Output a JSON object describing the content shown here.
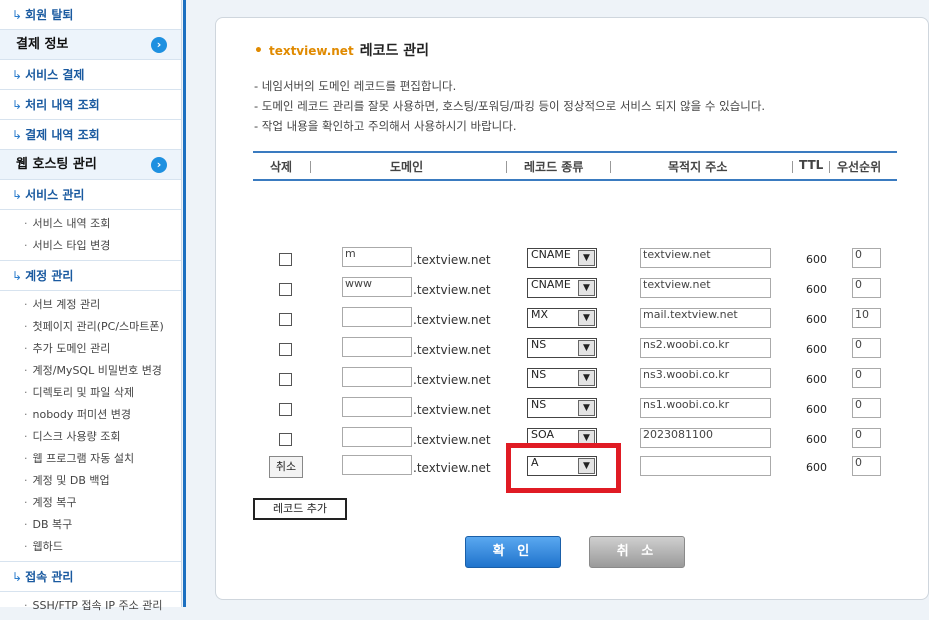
{
  "sidebar": {
    "sections": [
      {
        "label": "회원 탈퇴",
        "type": "link"
      },
      {
        "label": "결제 정보",
        "type": "header"
      },
      {
        "label": "서비스 결제",
        "type": "link"
      },
      {
        "label": "처리 내역 조회",
        "type": "link"
      },
      {
        "label": "결제 내역 조회",
        "type": "link"
      },
      {
        "label": "웹 호스팅 관리",
        "type": "header"
      },
      {
        "label": "서비스 관리",
        "type": "link"
      }
    ],
    "service_sub": [
      "서비스 내역 조회",
      "서비스 타입 변경"
    ],
    "account_label": "계정 관리",
    "account_sub": [
      "서브 계정 관리",
      "첫페이지 관리(PC/스마트폰)",
      "추가 도메인 관리",
      "계정/MySQL 비밀번호 변경",
      "디렉토리 및 파일 삭제",
      "nobody 퍼미션 변경",
      "디스크 사용량 조회",
      "웹 프로그램 자동 설치",
      "계정 및 DB 백업",
      "계정 복구",
      "DB 복구",
      "웹하드"
    ],
    "access_label": "접속 관리",
    "access_sub": [
      "SSH/FTP 접속 IP 주소 관리"
    ]
  },
  "main": {
    "domain": "textview.net",
    "title": "레코드 관리",
    "notes": [
      "- 네임서버의 도메인 레코드를 편집합니다.",
      "- 도메인 레코드 관리를 잘못 사용하면, 호스팅/포워딩/파킹 등이 정상적으로 서비스 되지 않을 수 있습니다.",
      "- 작업 내용을 확인하고 주의해서 사용하시기 바랍니다."
    ],
    "headers": {
      "delete": "삭제",
      "domain": "도메인",
      "type": "레코드 종류",
      "target": "목적지 주소",
      "ttl": "TTL",
      "priority": "우선순위"
    },
    "suffix": ".textview.net",
    "rows": [
      {
        "sub": "m",
        "type": "CNAME",
        "target": "textview.net",
        "ttl": "600",
        "priority": "0"
      },
      {
        "sub": "www",
        "type": "CNAME",
        "target": "textview.net",
        "ttl": "600",
        "priority": "0"
      },
      {
        "sub": "",
        "type": "MX",
        "target": "mail.textview.net",
        "ttl": "600",
        "priority": "10"
      },
      {
        "sub": "",
        "type": "NS",
        "target": "ns2.woobi.co.kr",
        "ttl": "600",
        "priority": "0"
      },
      {
        "sub": "",
        "type": "NS",
        "target": "ns3.woobi.co.kr",
        "ttl": "600",
        "priority": "0"
      },
      {
        "sub": "",
        "type": "NS",
        "target": "ns1.woobi.co.kr",
        "ttl": "600",
        "priority": "0"
      },
      {
        "sub": "",
        "type": "SOA",
        "target": "2023081100",
        "ttl": "600",
        "priority": "0"
      }
    ],
    "new_row": {
      "cancel": "취소",
      "sub": "",
      "type": "A",
      "target": "",
      "ttl": "600",
      "priority": "0"
    },
    "add_record": "레코드 추가",
    "ok": "확 인",
    "cancel": "취 소",
    "dropdown_glyph": "▼",
    "highlight_color": "#e01b24"
  }
}
